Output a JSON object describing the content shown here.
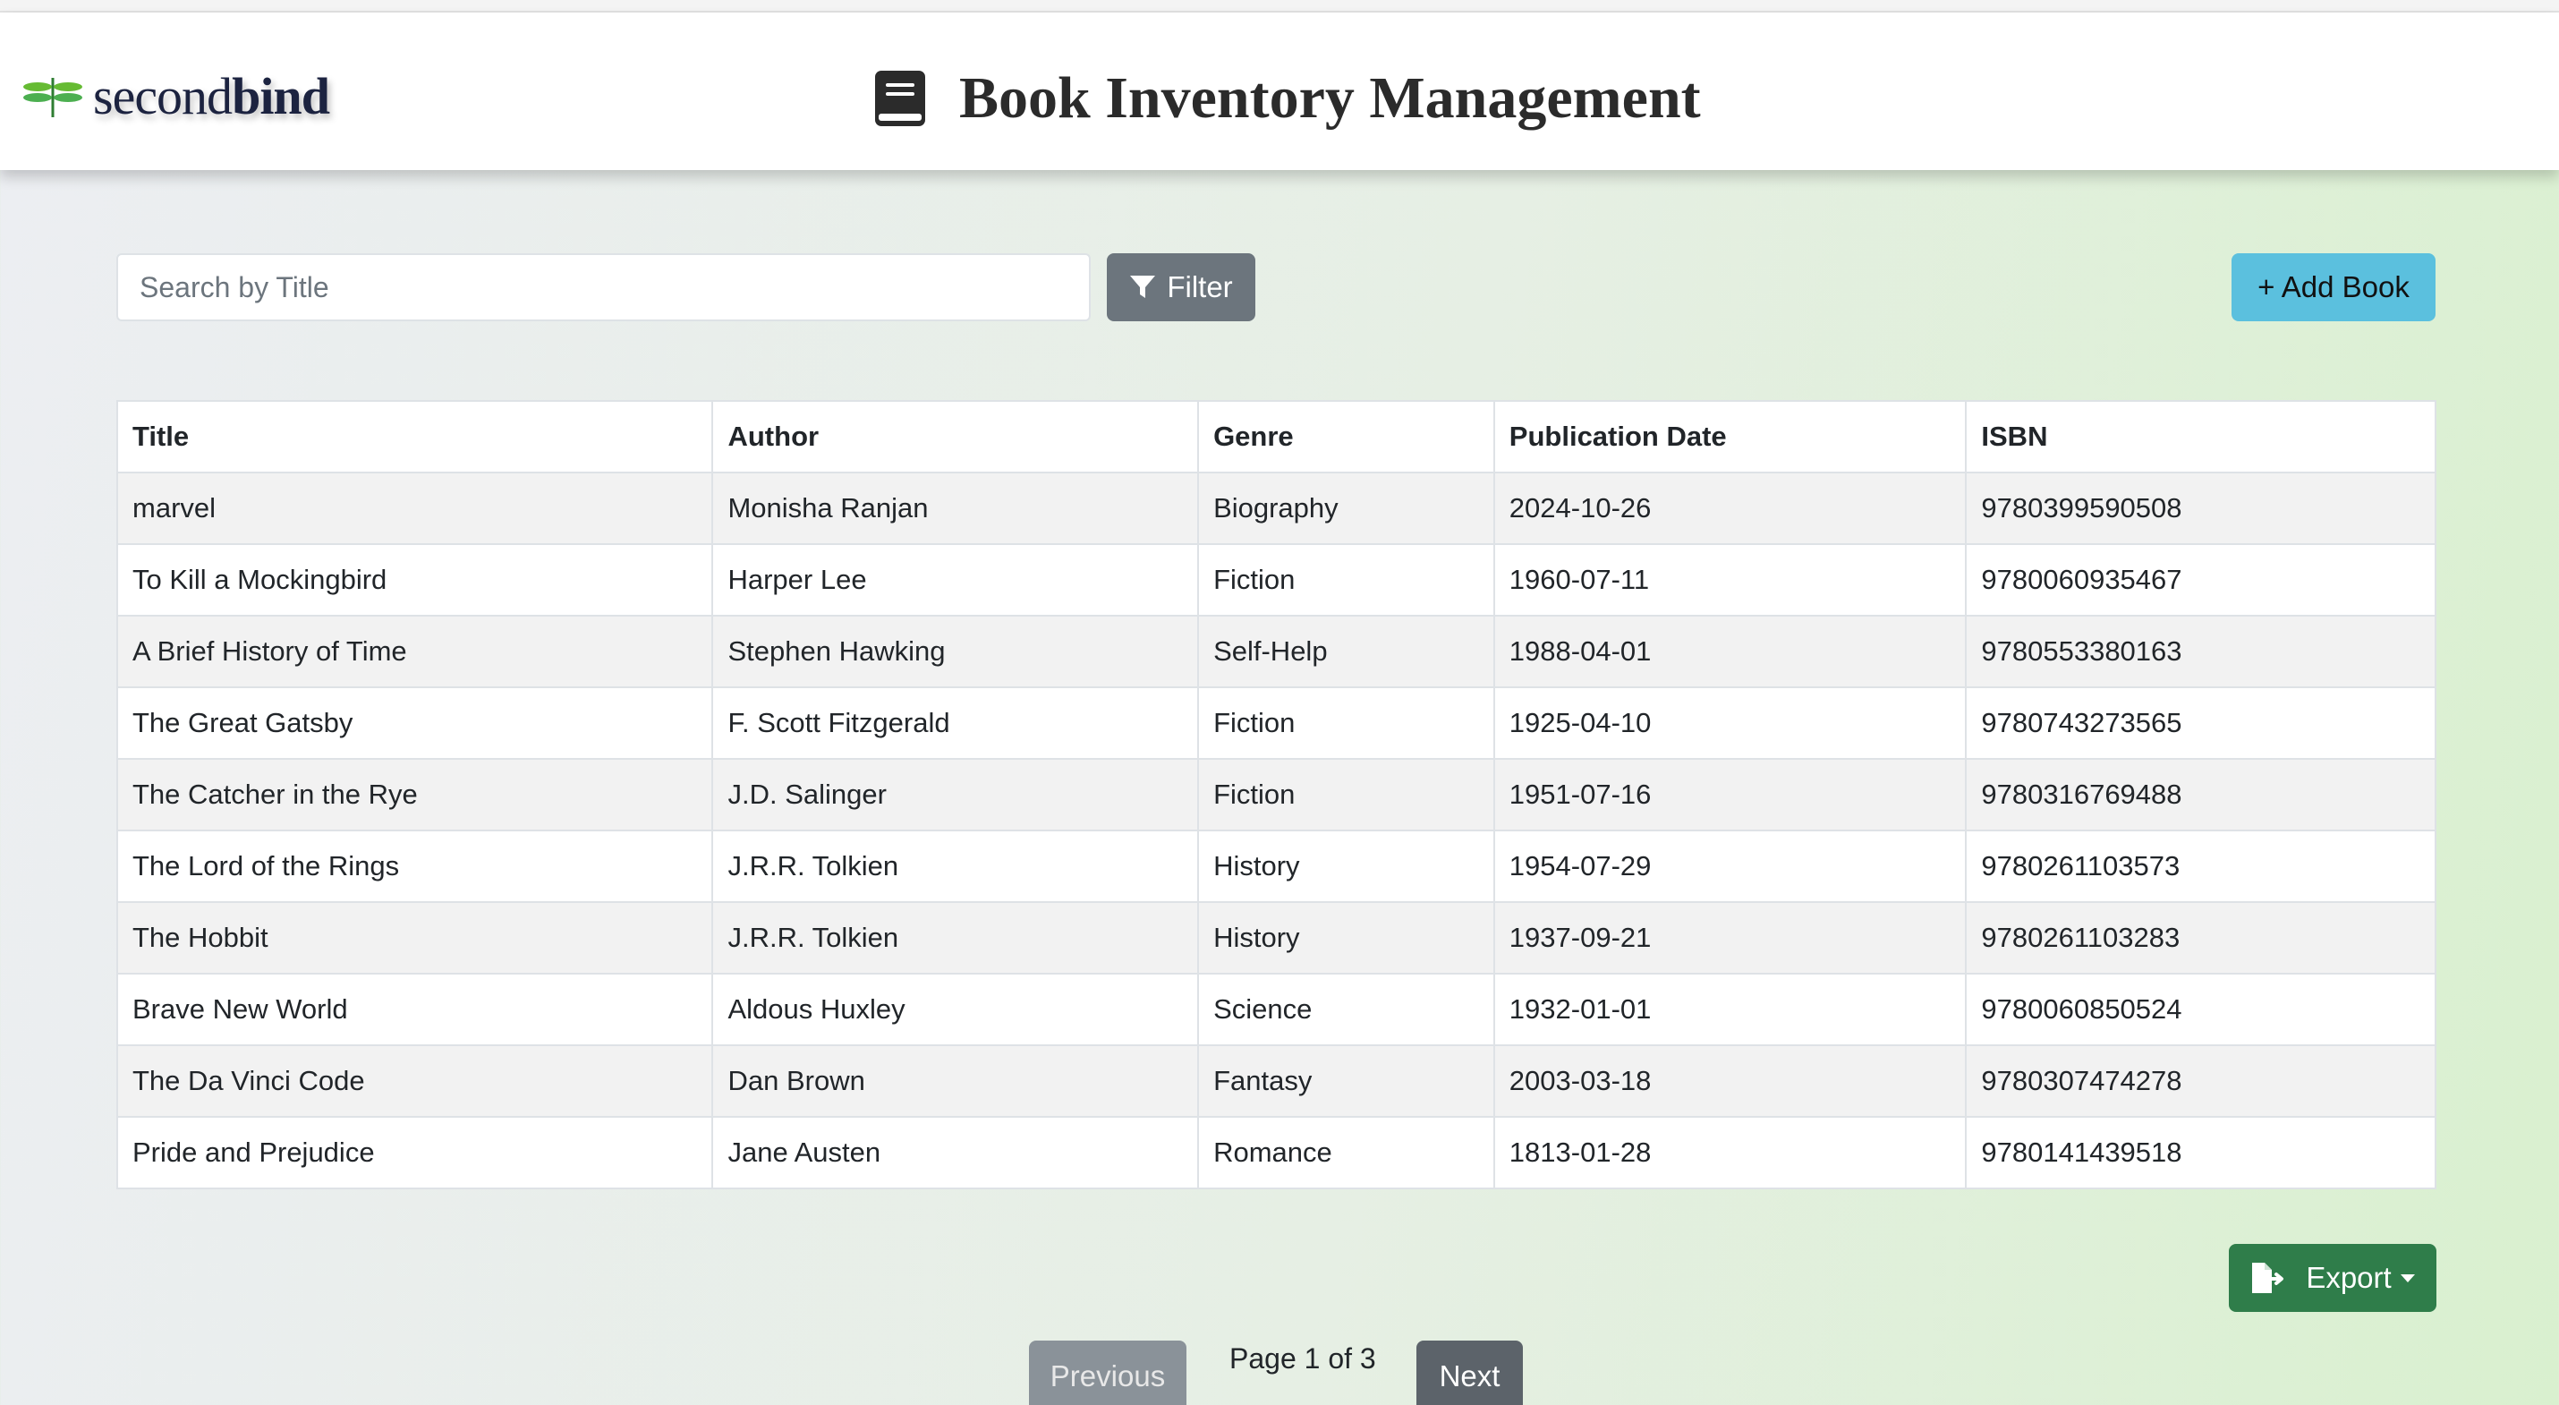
{
  "header": {
    "logo_text_light": "second",
    "logo_text_bold": "bind",
    "title": "Book Inventory Management"
  },
  "toolbar": {
    "search_placeholder": "Search by Title",
    "search_value": "",
    "filter_label": "Filter",
    "add_label": "+ Add Book"
  },
  "table": {
    "headers": [
      "Title",
      "Author",
      "Genre",
      "Publication Date",
      "ISBN"
    ],
    "rows": [
      [
        "marvel",
        "Monisha Ranjan",
        "Biography",
        "2024-10-26",
        "9780399590508"
      ],
      [
        "To Kill a Mockingbird",
        "Harper Lee",
        "Fiction",
        "1960-07-11",
        "9780060935467"
      ],
      [
        "A Brief History of Time",
        "Stephen Hawking",
        "Self-Help",
        "1988-04-01",
        "9780553380163"
      ],
      [
        "The Great Gatsby",
        "F. Scott Fitzgerald",
        "Fiction",
        "1925-04-10",
        "9780743273565"
      ],
      [
        "The Catcher in the Rye",
        "J.D. Salinger",
        "Fiction",
        "1951-07-16",
        "9780316769488"
      ],
      [
        "The Lord of the Rings",
        "J.R.R. Tolkien",
        "History",
        "1954-07-29",
        "9780261103573"
      ],
      [
        "The Hobbit",
        "J.R.R. Tolkien",
        "History",
        "1937-09-21",
        "9780261103283"
      ],
      [
        "Brave New World",
        "Aldous Huxley",
        "Science",
        "1932-01-01",
        "9780060850524"
      ],
      [
        "The Da Vinci Code",
        "Dan Brown",
        "Fantasy",
        "2003-03-18",
        "9780307474278"
      ],
      [
        "Pride and Prejudice",
        "Jane Austen",
        "Romance",
        "1813-01-28",
        "9780141439518"
      ]
    ]
  },
  "export": {
    "label": "Export"
  },
  "pagination": {
    "previous_label": "Previous",
    "page_info": "Page 1 of 3",
    "next_label": "Next"
  },
  "colors": {
    "filter_button": "#6c757d",
    "add_button": "#5bc0de",
    "export_button": "#2f7d4a",
    "next_button": "#5c636a",
    "previous_button_disabled": "#8a9299"
  },
  "icons": {
    "logo": "dragonfly-icon",
    "title": "book-icon",
    "filter": "filter-icon",
    "export": "file-export-icon",
    "export_caret": "caret-down-icon"
  }
}
